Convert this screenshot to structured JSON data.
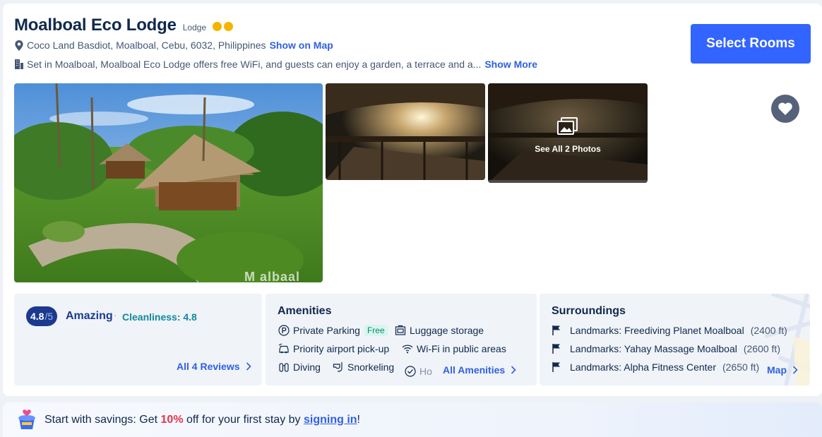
{
  "hotel": {
    "name": "Moalboal Eco Lodge",
    "type": "Lodge",
    "rating_dots": 2,
    "address": "Coco Land Basdiot, Moalboal, Cebu, 6032, Philippines",
    "show_on_map": "Show on Map",
    "description": "Set in Moalboal, Moalboal Eco Lodge offers free WiFi, and guests can enjoy a garden, a terrace and a...",
    "show_more": "Show More",
    "select_rooms": "Select Rooms"
  },
  "gallery": {
    "watermark": "M  albaal",
    "see_all": "See All 2 Photos"
  },
  "review": {
    "score": "4.8",
    "out_of": "/5",
    "label": "Amazing",
    "separator": "·",
    "cleanliness": "Cleanliness: 4.8",
    "all_reviews": "All 4 Reviews"
  },
  "amenities": {
    "title": "Amenities",
    "items": [
      {
        "label": "Private Parking",
        "tag": "Free",
        "icon": "parking-icon"
      },
      {
        "label": "Luggage storage",
        "icon": "luggage-icon"
      },
      {
        "label": "Priority airport pick-up",
        "icon": "airport-shuttle-icon"
      },
      {
        "label": "Wi-Fi in public areas",
        "icon": "wifi-icon"
      },
      {
        "label": "Diving",
        "icon": "diving-icon"
      },
      {
        "label": "Snorkeling",
        "icon": "snorkel-icon"
      },
      {
        "label": "Ho",
        "icon": "check-circle-icon"
      }
    ],
    "all_amenities": "All Amenities"
  },
  "surroundings": {
    "title": "Surroundings",
    "items": [
      {
        "label": "Landmarks: Freediving Planet Moalboal",
        "distance": "(2400 ft)"
      },
      {
        "label": "Landmarks: Yahay Massage Moalboal",
        "distance": "(2600 ft)"
      },
      {
        "label": "Landmarks: Alpha Fitness Center",
        "distance": "(2650 ft)"
      }
    ],
    "map_link": "Map"
  },
  "promo": {
    "before": "Start with savings: Get ",
    "percent": "10%",
    "middle": " off for your first stay by ",
    "signin": "signing in",
    "after": "!"
  },
  "colors": {
    "primary": "#3264ff",
    "link": "#2f60e0",
    "score_badge": "#1a3a8f",
    "cleanliness": "#0f8a9a",
    "rating_dot": "#f6b300",
    "promo_accent": "#e5364b"
  }
}
